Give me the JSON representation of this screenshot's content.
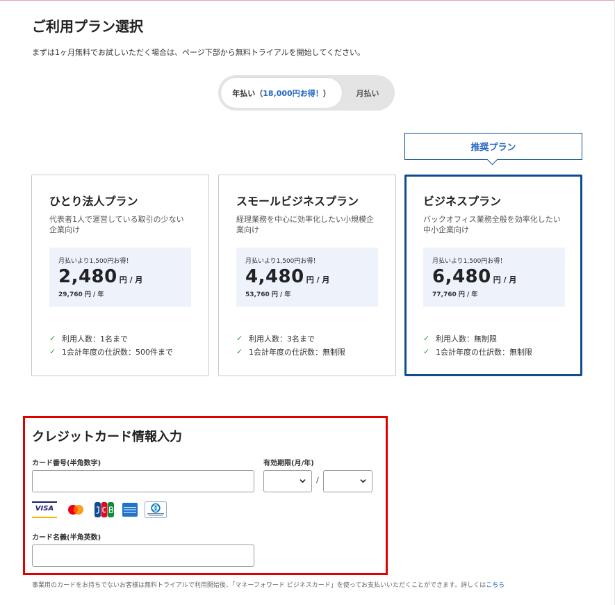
{
  "page": {
    "title": "ご利用プラン選択",
    "subtitle": "まずは1ヶ月無料でお試しいただく場合は、ページ下部から無料トライアルを開始してください。"
  },
  "billing_toggle": {
    "annual_label": "年払い（",
    "annual_savings": "18,000円お得！",
    "annual_close": "）",
    "monthly_label": "月払い",
    "selected": "annual"
  },
  "recommend_label": "推奨プラン",
  "plans": [
    {
      "name": "ひとり法人プラン",
      "description": "代表者1人で運営している取引の少ない企業向け",
      "saving": "月払いより1,500円お得！",
      "monthly_price": "2,480",
      "monthly_unit": "円 / 月",
      "yearly_price": "29,760 円 / 年",
      "features": [
        "利用人数：1名まで",
        "1会計年度の仕訳数：500件まで"
      ]
    },
    {
      "name": "スモールビジネスプラン",
      "description": "経理業務を中心に効率化したい小規模企業向け",
      "saving": "月払いより1,500円お得！",
      "monthly_price": "4,480",
      "monthly_unit": "円 / 月",
      "yearly_price": "53,760 円 / 年",
      "features": [
        "利用人数：3名まで",
        "1会計年度の仕訳数：無制限"
      ]
    },
    {
      "name": "ビジネスプラン",
      "description": "バックオフィス業務全般を効率化したい中小企業向け",
      "saving": "月払いより1,500円お得！",
      "monthly_price": "6,480",
      "monthly_unit": "円 / 月",
      "yearly_price": "77,760 円 / 年",
      "features": [
        "利用人数：無制限",
        "1会計年度の仕訳数：無制限"
      ],
      "selected": true
    }
  ],
  "credit_card": {
    "title": "クレジットカード情報入力",
    "number_label": "カード番号(半角数字)",
    "number_value": "",
    "expiry_label": "有効期限(月/年)",
    "expiry_month": "",
    "expiry_year": "",
    "expiry_separator": "/",
    "holder_label": "カード名義(半角英数)",
    "holder_value": "",
    "brands": [
      "visa-icon",
      "mastercard-icon",
      "jcb-icon",
      "amex-icon",
      "diners-club-icon"
    ],
    "visa_text": "VISA"
  },
  "footnote": {
    "text": "事業用のカードをお持ちでないお客様は無料トライアルで利用開始後、「マネーフォワード ビジネスカード」を使ってお支払いいただくことができます。詳しくは",
    "link": "こちら"
  },
  "colors": {
    "accent": "#2468c4",
    "selected_border": "#0e4d92",
    "highlight_border": "#e00000",
    "price_box": "#eef2fb",
    "check": "#2e9a3a"
  }
}
